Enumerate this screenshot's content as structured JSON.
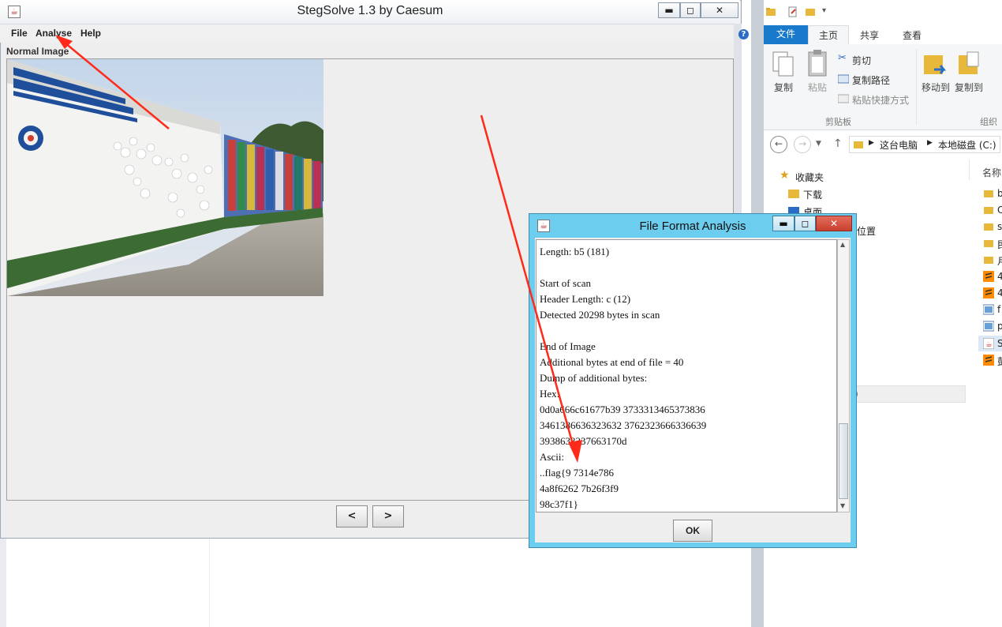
{
  "steg": {
    "title": "StegSolve 1.3 by Caesum",
    "menu": [
      "File",
      "Analyse",
      "Help"
    ],
    "view_label": "Normal Image",
    "prev_label": "<",
    "next_label": ">",
    "win_minimize": "▬",
    "win_maximize": "◻",
    "win_close": "✕"
  },
  "dialog": {
    "title": "File Format Analysis",
    "lines": [
      "Length: b5 (181)",
      "",
      "Start of scan",
      "Header Length: c (12)",
      "Detected 20298 bytes in scan",
      "",
      "End of Image",
      "Additional bytes at end of file = 40",
      "Dump of additional bytes:",
      "Hex:",
      "0d0a666c61677b39 3733313465373836",
      "3461386636323632 3762323666336639",
      "3938633337663170d",
      "Ascii:",
      "..flag{9 7314e786",
      "4a8f6262 7b26f3f9",
      "98c37f1}"
    ],
    "ok_label": "OK"
  },
  "explorer": {
    "tabs": {
      "file": "文件",
      "home": "主页",
      "share": "共享",
      "view": "查看"
    },
    "ribbon": {
      "copy": "复制",
      "paste": "粘贴",
      "cut": "剪切",
      "copy_path": "复制路径",
      "paste_shortcut": "粘贴快捷方式",
      "clipboard_group": "剪贴板",
      "move_to": "移动到",
      "copy_to": "复制到",
      "organize_group": "组织"
    },
    "address": {
      "root": "这台电脑",
      "drive": "本地磁盘 (C:)"
    },
    "tree": {
      "favorites": "收藏夹",
      "downloads": "下载",
      "desktop": "桌面",
      "recent": "位置"
    },
    "column_header": "名称",
    "file_initials": [
      "b",
      "C",
      "s",
      "民",
      "月",
      "4",
      "4",
      "f",
      "p",
      "S",
      "彭"
    ],
    "status_fragment": ")"
  }
}
